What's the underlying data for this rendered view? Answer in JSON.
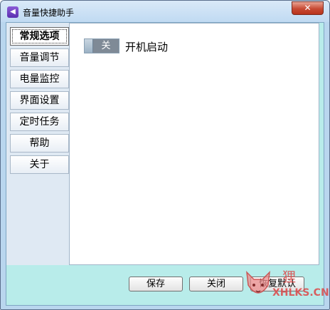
{
  "window": {
    "title": "音量快捷助手",
    "close_glyph": "✕"
  },
  "sidebar": {
    "items": [
      {
        "label": "常规选项",
        "active": true
      },
      {
        "label": "音量调节",
        "active": false
      },
      {
        "label": "电量监控",
        "active": false
      },
      {
        "label": "界面设置",
        "active": false
      },
      {
        "label": "定时任务",
        "active": false
      },
      {
        "label": "帮助",
        "active": false
      },
      {
        "label": "关于",
        "active": false
      }
    ]
  },
  "general": {
    "autostart_toggle_state": "关",
    "autostart_label": "开机启动"
  },
  "footer": {
    "save_label": "保存",
    "close_label": "关闭",
    "restore_label": "恢复默认"
  },
  "watermark": {
    "cn": "狸",
    "en": "XHLKS.CN"
  }
}
